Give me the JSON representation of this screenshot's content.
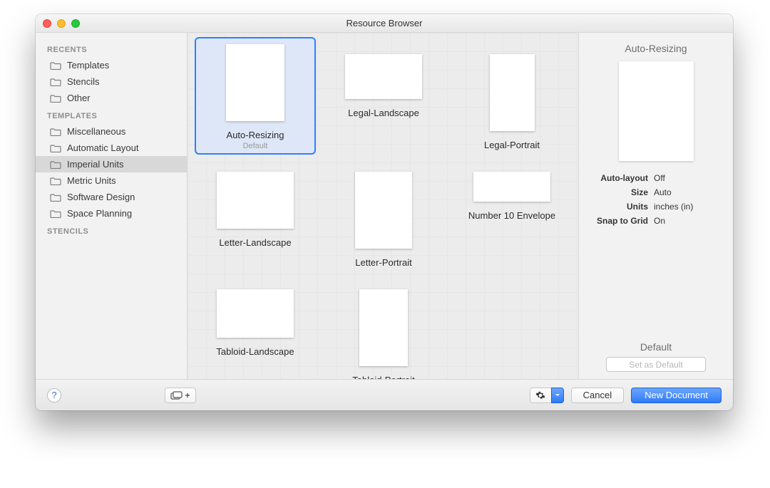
{
  "window": {
    "title": "Resource Browser"
  },
  "sidebar": {
    "sections": [
      {
        "heading": "RECENTS",
        "items": [
          {
            "label": "Templates",
            "selected": false
          },
          {
            "label": "Stencils",
            "selected": false
          },
          {
            "label": "Other",
            "selected": false
          }
        ]
      },
      {
        "heading": "TEMPLATES",
        "items": [
          {
            "label": "Miscellaneous",
            "selected": false
          },
          {
            "label": "Automatic Layout",
            "selected": false
          },
          {
            "label": "Imperial Units",
            "selected": true
          },
          {
            "label": "Metric Units",
            "selected": false
          },
          {
            "label": "Software Design",
            "selected": false
          },
          {
            "label": "Space Planning",
            "selected": false
          }
        ]
      },
      {
        "heading": "STENCILS",
        "items": []
      }
    ]
  },
  "templates": [
    {
      "label": "Auto-Resizing",
      "sub": "Default",
      "shape": "auto",
      "selected": true
    },
    {
      "label": "Legal-Landscape",
      "sub": "",
      "shape": "legal-l",
      "selected": false
    },
    {
      "label": "Legal-Portrait",
      "sub": "",
      "shape": "legal-p",
      "selected": false
    },
    {
      "label": "Letter-Landscape",
      "sub": "",
      "shape": "letter-l",
      "selected": false
    },
    {
      "label": "Letter-Portrait",
      "sub": "",
      "shape": "letter-p",
      "selected": false
    },
    {
      "label": "Number 10 Envelope",
      "sub": "",
      "shape": "env",
      "selected": false
    },
    {
      "label": "Tabloid-Landscape",
      "sub": "",
      "shape": "tab-l",
      "selected": false
    },
    {
      "label": "Tabloid-Portrait",
      "sub": "",
      "shape": "tab-p",
      "selected": false
    }
  ],
  "info": {
    "title": "Auto-Resizing",
    "rows": [
      {
        "k": "Auto-layout",
        "v": "Off"
      },
      {
        "k": "Size",
        "v": "Auto"
      },
      {
        "k": "Units",
        "v": "inches (in)"
      },
      {
        "k": "Snap to Grid",
        "v": "On"
      }
    ],
    "default_label": "Default",
    "set_default": "Set as Default"
  },
  "footer": {
    "help": "?",
    "add": "+",
    "cancel": "Cancel",
    "new_doc": "New Document"
  }
}
